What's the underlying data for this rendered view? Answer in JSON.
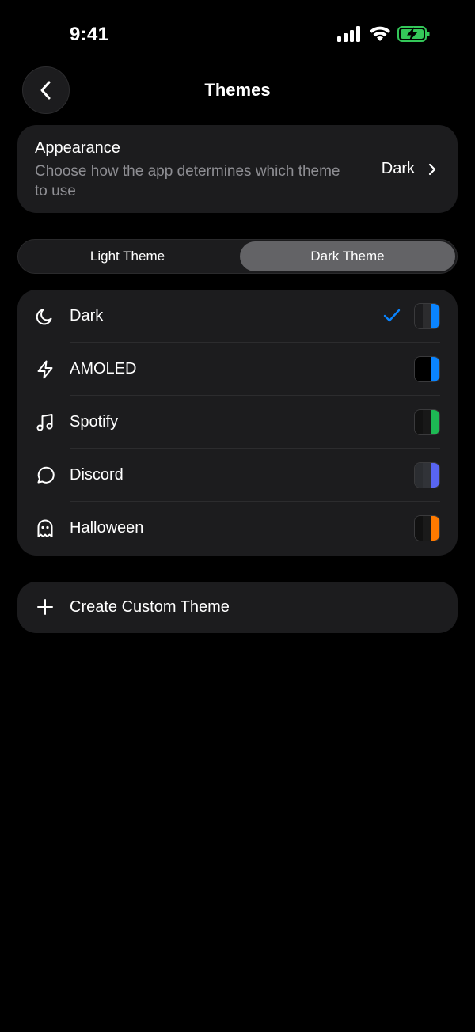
{
  "status": {
    "time": "9:41"
  },
  "nav": {
    "title": "Themes",
    "back_icon": "chevron-left-icon"
  },
  "appearance": {
    "title": "Appearance",
    "description": "Choose how the app determines which theme to use",
    "value": "Dark"
  },
  "segmented": {
    "options": [
      "Light Theme",
      "Dark Theme"
    ],
    "selected": "Dark Theme"
  },
  "themes": [
    {
      "label": "Dark",
      "icon": "moon-icon",
      "selected": true,
      "swatch": [
        "#1c1c1e",
        "#2c2c2e",
        "#0a84ff"
      ]
    },
    {
      "label": "AMOLED",
      "icon": "bolt-icon",
      "selected": false,
      "swatch": [
        "#000000",
        "#000000",
        "#0a84ff"
      ]
    },
    {
      "label": "Spotify",
      "icon": "music-note-icon",
      "selected": false,
      "swatch": [
        "#121212",
        "#181818",
        "#1db954"
      ]
    },
    {
      "label": "Discord",
      "icon": "chat-bubble-icon",
      "selected": false,
      "swatch": [
        "#2b2d31",
        "#313338",
        "#5865f2"
      ]
    },
    {
      "label": "Halloween",
      "icon": "ghost-icon",
      "selected": false,
      "swatch": [
        "#111111",
        "#1a1a1a",
        "#ff7a00"
      ]
    }
  ],
  "create": {
    "label": "Create Custom Theme",
    "icon": "plus-icon"
  },
  "colors": {
    "background": "#000000",
    "card": "#1c1c1e",
    "accent": "#0a84ff",
    "secondary_text": "#8e8e93"
  }
}
